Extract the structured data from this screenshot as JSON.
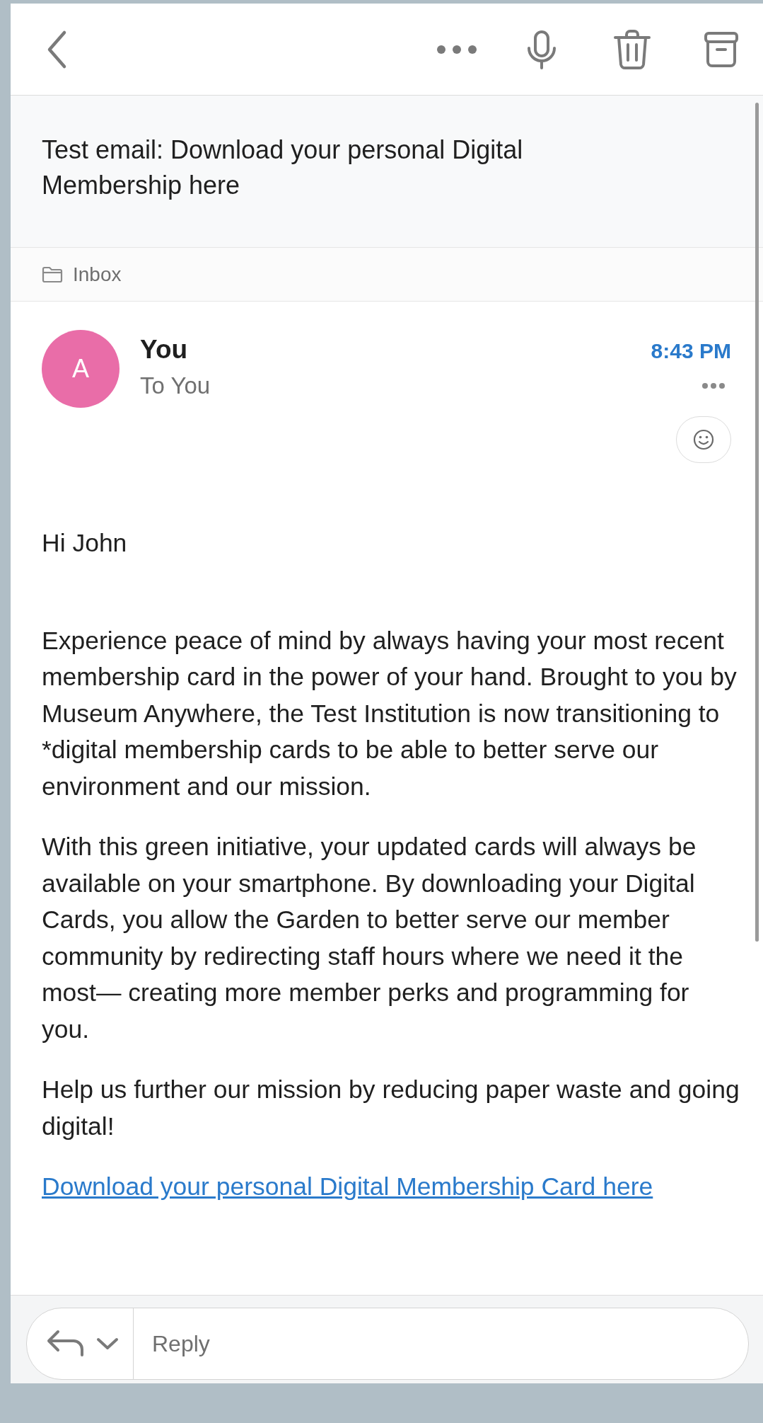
{
  "subject": "Test email: Download your personal Digital Membership here",
  "folder": "Inbox",
  "sender": {
    "initial": "A",
    "name": "You",
    "recipient": "To You",
    "time": "8:43 PM"
  },
  "body": [
    {
      "kind": "greeting",
      "text": "Hi John"
    },
    {
      "kind": "text",
      "text": "Experience peace of mind by always having your most recent membership card in the power of your hand. Brought to you by Museum Anywhere, the Test Institution is now transitioning to *digital membership cards to be able to better serve our environment and our mission."
    },
    {
      "kind": "text",
      "text": "With this green initiative, your updated cards will always be available on your smartphone. By downloading your Digital Cards, you allow the Garden to better serve our member community by redirecting staff hours where we need it the most— creating more member perks and programming for you."
    },
    {
      "kind": "text",
      "text": "Help us further our mission by reducing paper waste and going digital!"
    },
    {
      "kind": "link",
      "text": "Download your personal Digital Membership Card here"
    }
  ],
  "reply": {
    "placeholder": "Reply"
  }
}
